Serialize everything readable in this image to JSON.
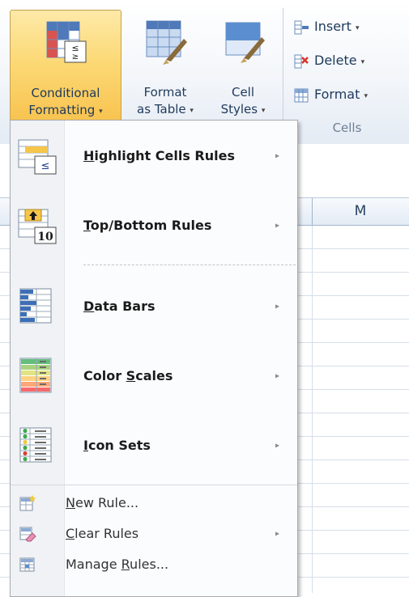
{
  "ribbon": {
    "conditional_formatting": {
      "line1": "Conditional",
      "line2": "Formatting",
      "caret": "▾"
    },
    "format_as_table": {
      "line1": "Format",
      "line2": "as Table",
      "caret": "▾"
    },
    "cell_styles": {
      "line1": "Cell",
      "line2": "Styles",
      "caret": "▾"
    },
    "cells_group": {
      "insert": {
        "label": "Insert",
        "caret": "▾"
      },
      "delete": {
        "label": "Delete",
        "caret": "▾"
      },
      "format": {
        "label": "Format",
        "caret": "▾"
      },
      "group_label": "Cells"
    }
  },
  "sheet": {
    "column_header": "M"
  },
  "menu": {
    "items": [
      {
        "pre": "",
        "key": "H",
        "post": "ighlight Cells Rules",
        "arrow": "▸",
        "icon": "highlight-cells-rules-icon"
      },
      {
        "pre": "",
        "key": "T",
        "post": "op/Bottom Rules",
        "arrow": "▸",
        "icon": "top-bottom-rules-icon"
      },
      {
        "pre": "",
        "key": "D",
        "post": "ata Bars",
        "arrow": "▸",
        "icon": "data-bars-icon"
      },
      {
        "pre": "Color ",
        "key": "S",
        "post": "cales",
        "arrow": "▸",
        "icon": "color-scales-icon"
      },
      {
        "pre": "",
        "key": "I",
        "post": "con Sets",
        "arrow": "▸",
        "icon": "icon-sets-icon"
      }
    ],
    "actions": [
      {
        "pre": "",
        "key": "N",
        "post": "ew Rule...",
        "arrow": "",
        "icon": "new-rule-icon"
      },
      {
        "pre": "",
        "key": "C",
        "post": "lear Rules",
        "arrow": "▸",
        "icon": "clear-rules-icon"
      },
      {
        "pre": "Manage ",
        "key": "R",
        "post": "ules...",
        "arrow": "",
        "icon": "manage-rules-icon"
      }
    ]
  },
  "colors": {
    "active_button": "#fcd976",
    "ribbon_text": "#1e395b",
    "menu_bg": "#fbfcfe"
  }
}
